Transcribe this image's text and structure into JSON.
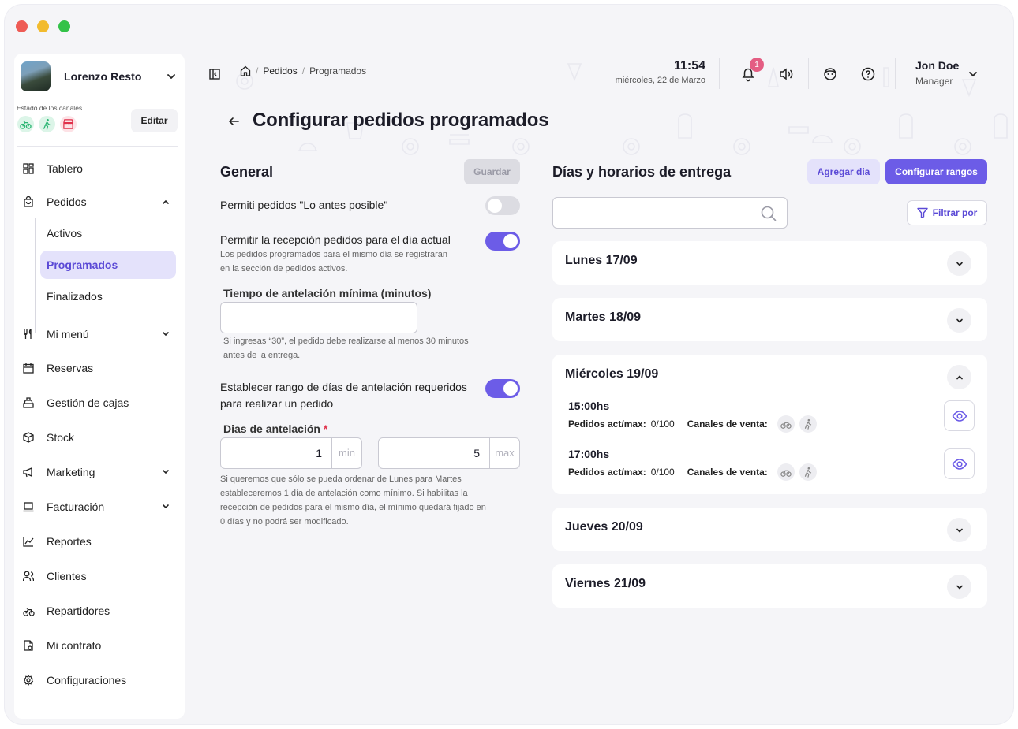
{
  "sidebar": {
    "restaurant_name": "Lorenzo Resto",
    "channels_label": "Estado de los canales",
    "edit_label": "Editar",
    "items": {
      "tablero": "Tablero",
      "pedidos": "Pedidos",
      "activos": "Activos",
      "programados": "Programados",
      "finalizados": "Finalizados",
      "mi_menu": "Mi menú",
      "reservas": "Reservas",
      "gestion_cajas": "Gestión de cajas",
      "stock": "Stock",
      "marketing": "Marketing",
      "facturacion": "Facturación",
      "reportes": "Reportes",
      "clientes": "Clientes",
      "repartidores": "Repartidores",
      "mi_contrato": "Mi contrato",
      "configuraciones": "Configuraciones"
    }
  },
  "header": {
    "breadcrumb": [
      "Pedidos",
      "Programados"
    ],
    "time": "11:54",
    "date": "miércoles, 22 de Marzo",
    "notifications_count": "1",
    "user_name": "Jon Doe",
    "user_role": "Manager"
  },
  "page": {
    "title": "Configurar pedidos programados"
  },
  "general": {
    "title": "General",
    "save_label": "Guardar",
    "asap_label": "Permiti pedidos \"Lo antes posible\"",
    "asap_enabled": false,
    "same_day_label": "Permitir la recepción pedidos para el día actual",
    "same_day_help_1": "Los pedidos programados para el mismo día se registrarán",
    "same_day_help_2": "en la sección de pedidos activos.",
    "same_day_enabled": true,
    "min_time_label": "Tiempo de antelación mínima (minutos)",
    "min_time_value": "",
    "min_time_help_1": "Si ingresas “30”, el pedido debe realizarse al menos 30 minutos",
    "min_time_help_2": "antes de la entrega.",
    "range_label_1": "Establecer rango de días de antelación requeridos",
    "range_label_2": "para realizar un pedido",
    "range_enabled": true,
    "days_label": "Dias de antelación",
    "required_mark": "*",
    "min_value": "1",
    "min_suffix": "min",
    "max_value": "5",
    "max_suffix": "max",
    "days_help_1": "Si queremos que sólo se pueda ordenar de Lunes para Martes",
    "days_help_2": "estableceremos 1 día de antelación como mínimo. Si habilitas la",
    "days_help_3": "recepción de pedidos para el mismo día, el mínimo quedará fijado en",
    "days_help_4": "0 días y no podrá ser modificado."
  },
  "delivery": {
    "title": "Días y horarios de entrega",
    "add_day_label": "Agregar dia",
    "configure_label": "Configurar rangos",
    "search_value": "",
    "filter_label": "Filtrar por",
    "days": [
      {
        "name": "Lunes 17/09",
        "expanded": false
      },
      {
        "name": "Martes 18/09",
        "expanded": false
      },
      {
        "name": "Miércoles 19/09",
        "expanded": true
      },
      {
        "name": "Jueves 20/09",
        "expanded": false
      },
      {
        "name": "Viernes 21/09",
        "expanded": false
      }
    ],
    "slots": [
      {
        "time": "15:00hs",
        "orders_label": "Pedidos act/max:",
        "orders_value": "0/100",
        "channels_label": "Canales de venta:"
      },
      {
        "time": "17:00hs",
        "orders_label": "Pedidos act/max:",
        "orders_value": "0/100",
        "channels_label": "Canales de venta:"
      }
    ]
  },
  "colors": {
    "accent": "#6c5ce7",
    "accent_soft": "#e4e2fb",
    "badge": "#e45d83",
    "channel_green": "#2bb673",
    "channel_red": "#e0314b"
  }
}
